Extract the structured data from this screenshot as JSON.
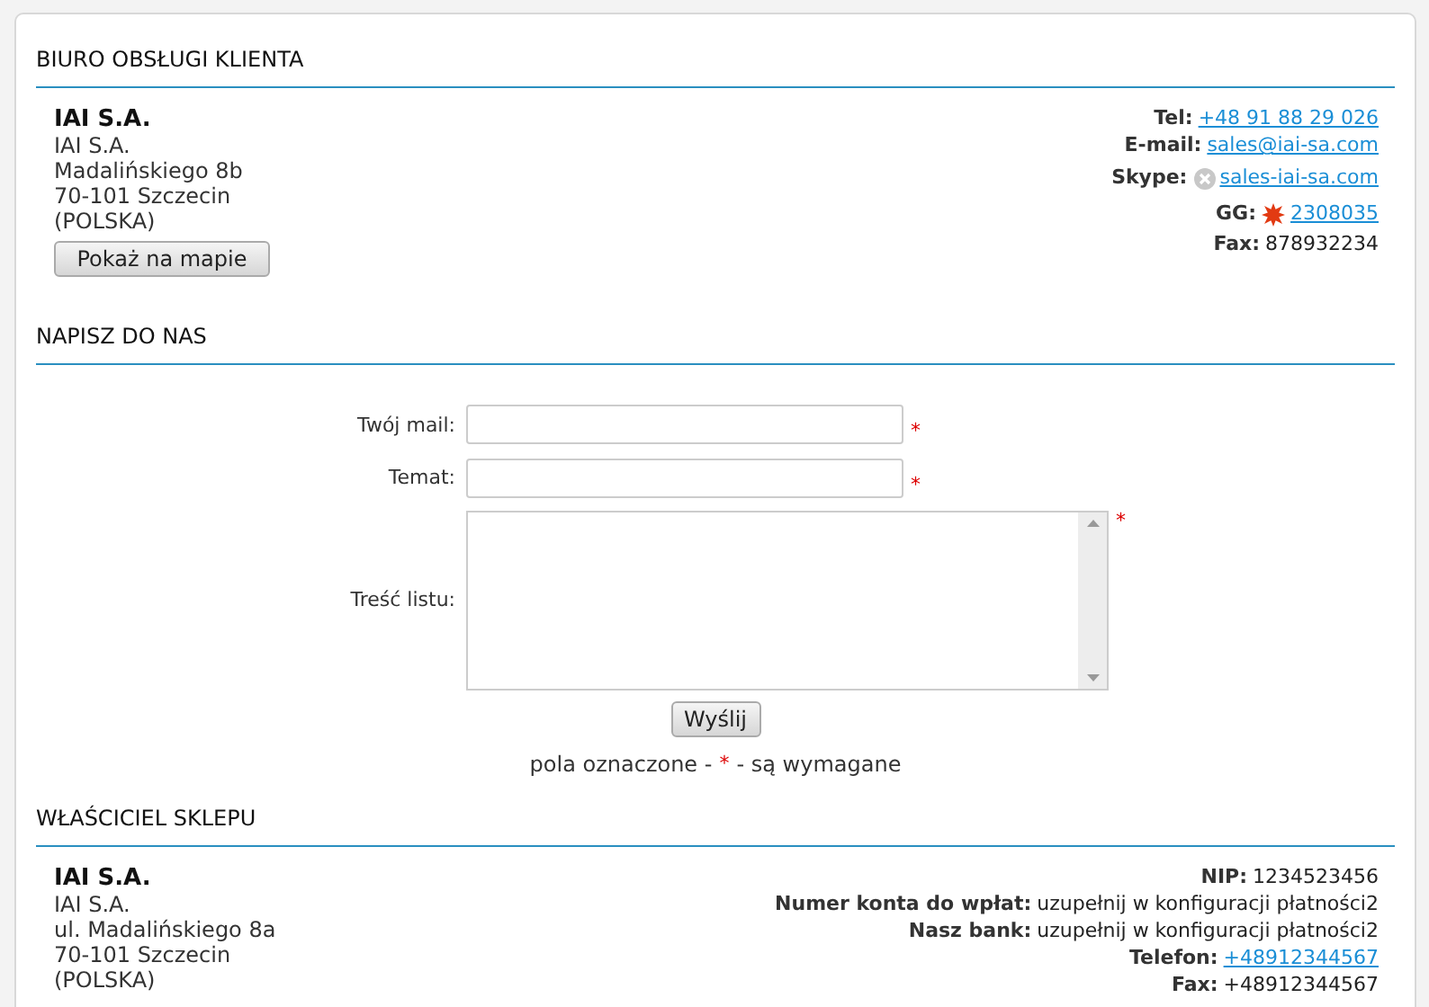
{
  "contact": {
    "heading": "BIURO OBSŁUGI KLIENTA",
    "address": {
      "name": "IAI S.A.",
      "lines": [
        "IAI S.A.",
        "Madalińskiego 8b",
        "70-101 Szczecin",
        "(POLSKA)"
      ]
    },
    "map_button": "Pokaż na mapie",
    "details": [
      {
        "label": "Tel:",
        "value": "+48 91 88 29 026",
        "kind": "link"
      },
      {
        "label": "E-mail:",
        "value": "sales@iai-sa.com",
        "kind": "link"
      },
      {
        "label": "Skype:",
        "value": "sales-iai-sa.com",
        "kind": "skype_link"
      },
      {
        "label": "GG:",
        "value": "2308035",
        "kind": "gg_link"
      },
      {
        "label": "Fax:",
        "value": "878932234",
        "kind": "text"
      }
    ]
  },
  "form": {
    "heading": "NAPISZ DO NAS",
    "fields": [
      {
        "label": "Twój mail:",
        "kind": "input",
        "required": true
      },
      {
        "label": "Temat:",
        "kind": "input",
        "required": true
      },
      {
        "label": "Treść listu:",
        "kind": "textarea",
        "required": true
      }
    ],
    "submit": "Wyślij",
    "note": {
      "before": "pola oznaczone -",
      "mark": "*",
      "after": "- są wymagane"
    }
  },
  "owner": {
    "heading": "WŁAŚCICIEL SKLEPU",
    "address": {
      "name": "IAI S.A.",
      "lines": [
        "IAI S.A.",
        "ul. Madalińskiego 8a",
        "70-101 Szczecin",
        "(POLSKA)"
      ]
    },
    "details": [
      {
        "label": "NIP:",
        "value": "1234523456",
        "kind": "text"
      },
      {
        "label": "Numer konta do wpłat:",
        "value": "uzupełnij w konfiguracji płatności2",
        "kind": "text"
      },
      {
        "label": "Nasz bank:",
        "value": "uzupełnij w konfiguracji płatności2",
        "kind": "text"
      },
      {
        "label": "Telefon:",
        "value": "+48912344567",
        "kind": "link"
      },
      {
        "label": "Fax:",
        "value": "+48912344567",
        "kind": "text"
      }
    ]
  }
}
